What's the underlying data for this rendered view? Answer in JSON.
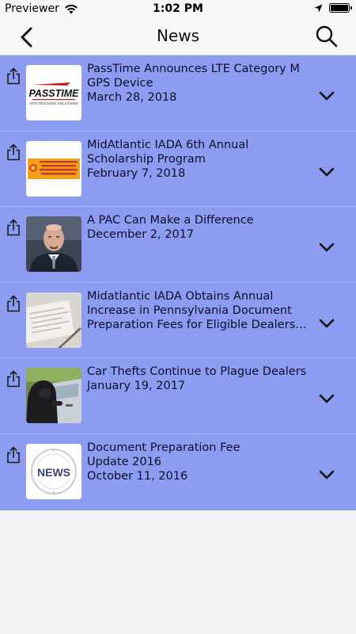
{
  "status_bar": {
    "carrier": "Previewer",
    "time": "1:02 PM"
  },
  "nav": {
    "title": "News"
  },
  "news": [
    {
      "title": "PassTime Announces LTE Category M\nGPS Device",
      "date": "March 28, 2018",
      "thumb": "PassTime GPS logo"
    },
    {
      "title": "MidAtlantic IADA 6th Annual\nScholarship Program",
      "date": "February 7, 2018",
      "thumb": "orange scholarship banner"
    },
    {
      "title": "A PAC Can Make a Difference",
      "date": "December 2, 2017",
      "thumb": "portrait of man in suit"
    },
    {
      "title": "Midatlantic IADA Obtains Annual\nIncrease in Pennsylvania Document\nPreparation Fees for Eligible Dealers…",
      "date": "",
      "thumb": "documents and pen"
    },
    {
      "title": "Car Thefts Continue to Plague Dealers",
      "date": "January 19, 2017",
      "thumb": "hooded thief at car door"
    },
    {
      "title": "Document Preparation Fee\nUpdate 2016",
      "date": "October 11, 2016",
      "thumb": "NEWS seal"
    }
  ],
  "colors": {
    "list_background": "#8c9cf0",
    "row_divider": "#a8b2ec",
    "bar_background": "#f7f7f7"
  },
  "icons": {
    "back": "chevron-left-icon",
    "search": "search-icon",
    "share": "share-icon",
    "expand": "chevron-down-icon"
  }
}
